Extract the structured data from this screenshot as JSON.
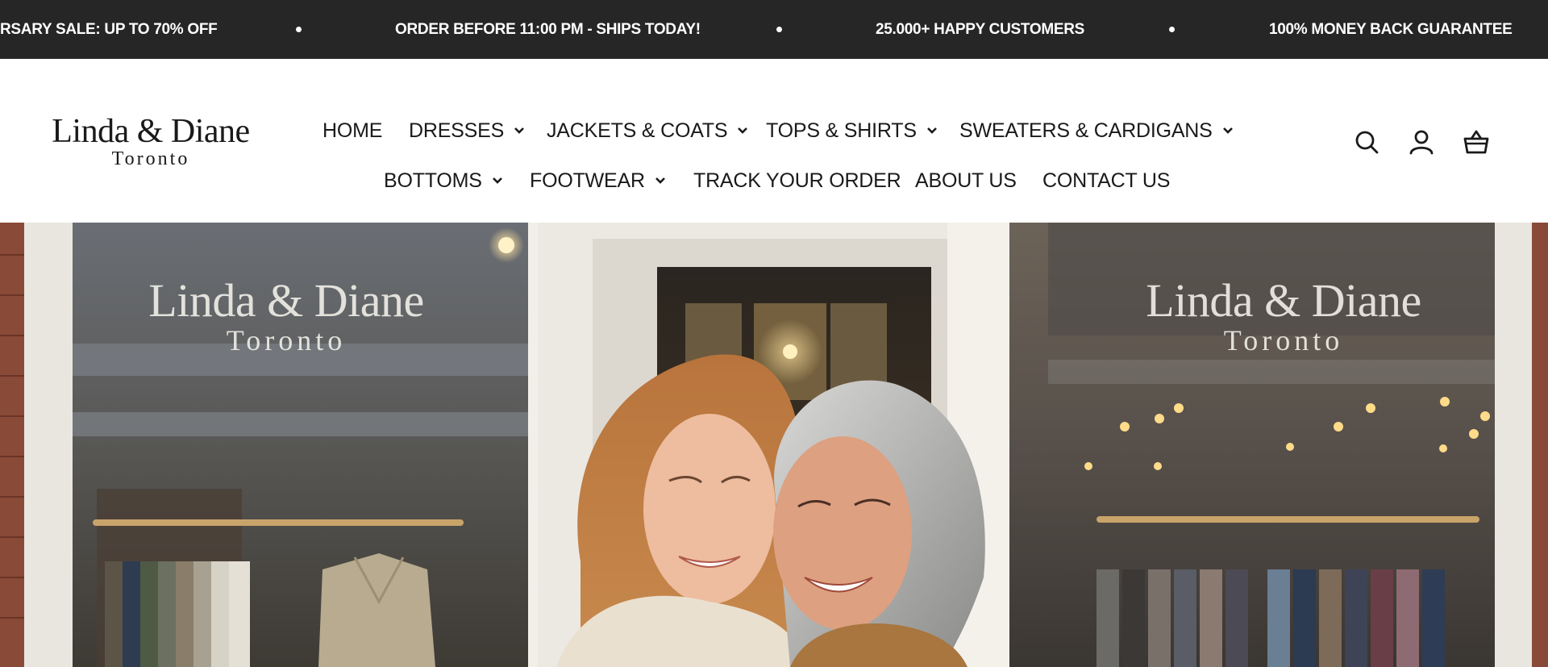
{
  "announcement": {
    "messages": [
      "RSARY SALE: UP TO 70% OFF",
      "ORDER BEFORE 11:00 PM - SHIPS TODAY!",
      "25.000+ HAPPY CUSTOMERS",
      "100% MONEY BACK GUARANTEE"
    ]
  },
  "logo": {
    "line1": "Linda & Diane",
    "line2": "Toronto"
  },
  "nav": {
    "items": [
      {
        "label": "HOME",
        "has_dropdown": false
      },
      {
        "label": "DRESSES",
        "has_dropdown": true
      },
      {
        "label": "JACKETS & COATS",
        "has_dropdown": true
      },
      {
        "label": "TOPS & SHIRTS",
        "has_dropdown": true
      },
      {
        "label": "SWEATERS & CARDIGANS",
        "has_dropdown": true
      },
      {
        "label": "BOTTOMS",
        "has_dropdown": true
      },
      {
        "label": "FOOTWEAR",
        "has_dropdown": true
      },
      {
        "label": "TRACK YOUR ORDER",
        "has_dropdown": false
      },
      {
        "label": "ABOUT US",
        "has_dropdown": false
      },
      {
        "label": "CONTACT US",
        "has_dropdown": false
      }
    ]
  },
  "header_icons": [
    "search-icon",
    "account-icon",
    "cart-icon"
  ],
  "hero": {
    "left_window_sign": {
      "line1": "Linda & Diane",
      "line2": "Toronto"
    },
    "right_window_sign": {
      "line1": "Linda & Diane",
      "line2": "Toronto"
    }
  },
  "colors": {
    "announcement_bg": "#262626",
    "text": "#1a1a1a",
    "background": "#ffffff"
  }
}
